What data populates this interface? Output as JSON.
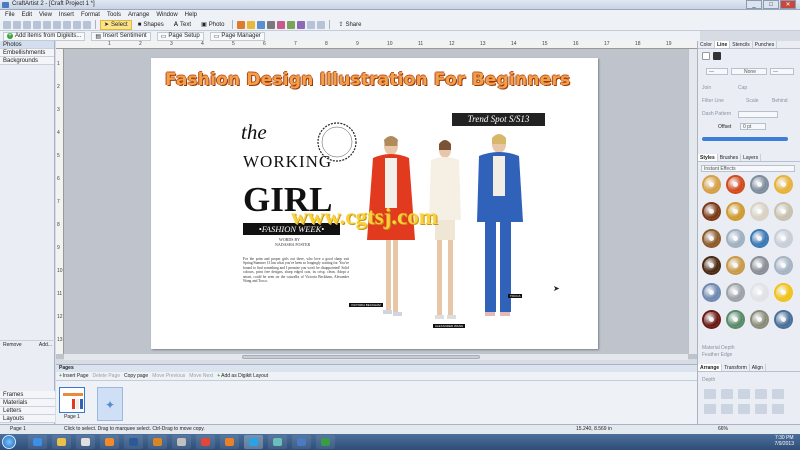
{
  "window": {
    "title": "CraftArtist 2 - [Craft Project 1 *]",
    "controls": [
      "_",
      "□",
      "✕"
    ]
  },
  "menu": [
    "File",
    "Edit",
    "View",
    "Insert",
    "Format",
    "Tools",
    "Arrange",
    "Window",
    "Help"
  ],
  "toolbar1": {
    "select": "Select",
    "shapes": "Shapes",
    "text": "Text",
    "photo": "Photo",
    "share": "Share"
  },
  "toolbar2": {
    "add_items": "Add items from Digikits...",
    "insert_sentiment": "Insert Sentiment",
    "page_setup": "Page Setup",
    "page_manager": "Page Manager"
  },
  "left_panel": {
    "tabs": [
      "Photos",
      "Embellishments",
      "Backgrounds"
    ],
    "bottom_tabs": [
      "Frames",
      "Materials",
      "Letters",
      "Layouts"
    ],
    "remove": "Remove",
    "add": "Add..."
  },
  "ruler": {
    "h_numbers": [
      "1",
      "2",
      "3",
      "4",
      "5",
      "6",
      "7",
      "8",
      "9",
      "10",
      "11",
      "12",
      "13",
      "14",
      "15",
      "16",
      "17",
      "18",
      "19",
      "20"
    ],
    "v_numbers": [
      "1",
      "2",
      "3",
      "4",
      "5",
      "6",
      "7",
      "8",
      "9",
      "10",
      "11",
      "12",
      "13"
    ]
  },
  "page": {
    "headline": "Fashion Design Illustration For Beginners",
    "the": "the",
    "working": "WORKING",
    "girl": "GIRL",
    "fashion_week": "•FASHION WEEK•",
    "credit1": "WORDS BY",
    "credit2": "NADASHA FOSTER",
    "body": "For the prim and proper girls out there, who love a good sharp suit Spring/Summer 13 has what you've been so longingly waiting for. You've bound to find something and I promise you won't be disappointed! Solid colours, print free designs, sharp edged cuts, its crisp, clean. Adopt a smart, could be seen on the catwalks of Victoria Beckham, Alexander Wang and Tocca.",
    "trend_spot": "Trend Spot S/S13",
    "watermark": "www.cgtsj.com",
    "caption1": "VICTORIA BECKHAM",
    "caption2": "ALEXANDER WANG",
    "caption3": "TOCCA"
  },
  "right_panel": {
    "tabs": [
      "Color",
      "Line",
      "Stencils",
      "Punches"
    ],
    "line_style": "None",
    "offset_label": "Offset",
    "offset_value": "0 pt",
    "fields": [
      "Join",
      "Cap",
      "Scale",
      "Behind",
      "Filter Line",
      "Dash Pattern"
    ],
    "styles_tabs": [
      "Styles",
      "Brushes",
      "Layers"
    ],
    "effects_dropdown": "Instant Effects",
    "arrange_tabs": [
      "Arrange",
      "Transform",
      "Align"
    ],
    "depth_label": "Depth",
    "material_depth": "Material Depth",
    "feather_edge": "Feather Edge"
  },
  "gears": [
    "#d6a046",
    "#d24a1c",
    "#7f8c9c",
    "#e6b23a",
    "#7b3a16",
    "#cf9b30",
    "#d9d2c4",
    "#c7c1ae",
    "#8c5a2a",
    "#9fb0c0",
    "#3c79b4",
    "#c8ced6",
    "#4a2a12",
    "#c89a4a",
    "#8a8f97",
    "#a6b4c4",
    "#6f88b2",
    "#9ea2a8",
    "#e0e2e6",
    "#f1c21a",
    "#6a1a12",
    "#5a8a6a",
    "#8a8c7a",
    "#4a6f98"
  ],
  "pages_panel": {
    "header": "Pages",
    "buttons": [
      "Insert Page",
      "Delete Page",
      "Copy page",
      "Move Previous",
      "Move Next",
      "Add as Digikit Layout"
    ],
    "page_label": "Page 1"
  },
  "status": {
    "page": "Page 1",
    "hint": "Click to select. Drag to marquee select. Ctrl-Drag to move copy.",
    "coords": "15.240, 8.569 in",
    "zoom": "66%"
  },
  "clock": {
    "time": "7:30 PM",
    "date": "7/9/2013"
  }
}
